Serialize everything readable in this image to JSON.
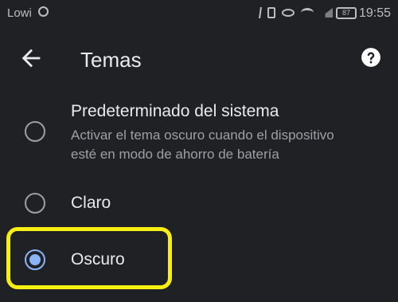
{
  "status_bar": {
    "carrier": "Lowi",
    "battery": "87",
    "time": "19:55"
  },
  "header": {
    "title": "Temas",
    "back_icon": "arrow-back-icon",
    "help_icon": "help-circle-icon"
  },
  "options": [
    {
      "label": "Predeterminado del sistema",
      "description_line1": "Activar el tema oscuro cuando el dispositivo",
      "description_line2": "esté en modo de ahorro de batería",
      "selected": false
    },
    {
      "label": "Claro",
      "selected": false
    },
    {
      "label": "Oscuro",
      "selected": true
    }
  ],
  "colors": {
    "background": "#202124",
    "accent": "#8ab4f8",
    "highlight": "#f7ee12"
  }
}
